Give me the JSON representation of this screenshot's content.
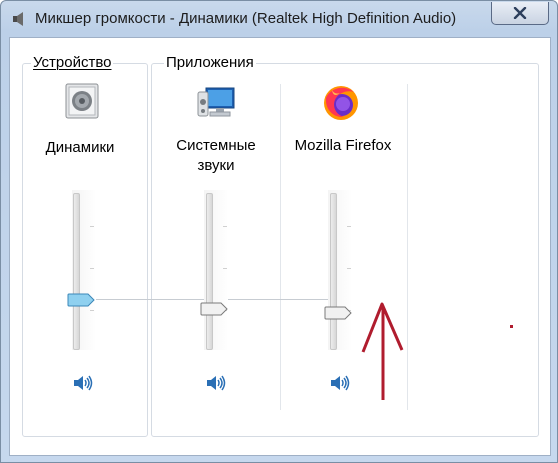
{
  "window": {
    "title": "Микшер громкости - Динамики (Realtek High Definition Audio)",
    "close_label": "✕"
  },
  "device_group": {
    "label": "Устройство",
    "device": {
      "name": "Динамики",
      "icon": "speaker-device-icon",
      "volume_level": 0.3,
      "muted": false
    }
  },
  "apps_group": {
    "label": "Приложения",
    "apps": [
      {
        "name_line1": "Системные",
        "name_line2": "звуки",
        "icon": "system-sounds-icon",
        "volume_level": 0.3,
        "muted": false
      },
      {
        "name_line1": "Mozilla Firefox",
        "name_line2": "",
        "icon": "firefox-icon",
        "volume_level": 0.3,
        "muted": false
      }
    ]
  },
  "annotation": {
    "arrow_color": "#b01c2e"
  },
  "colors": {
    "accent": "#2a6fb5",
    "thumb_active": "#8fd0ef"
  }
}
